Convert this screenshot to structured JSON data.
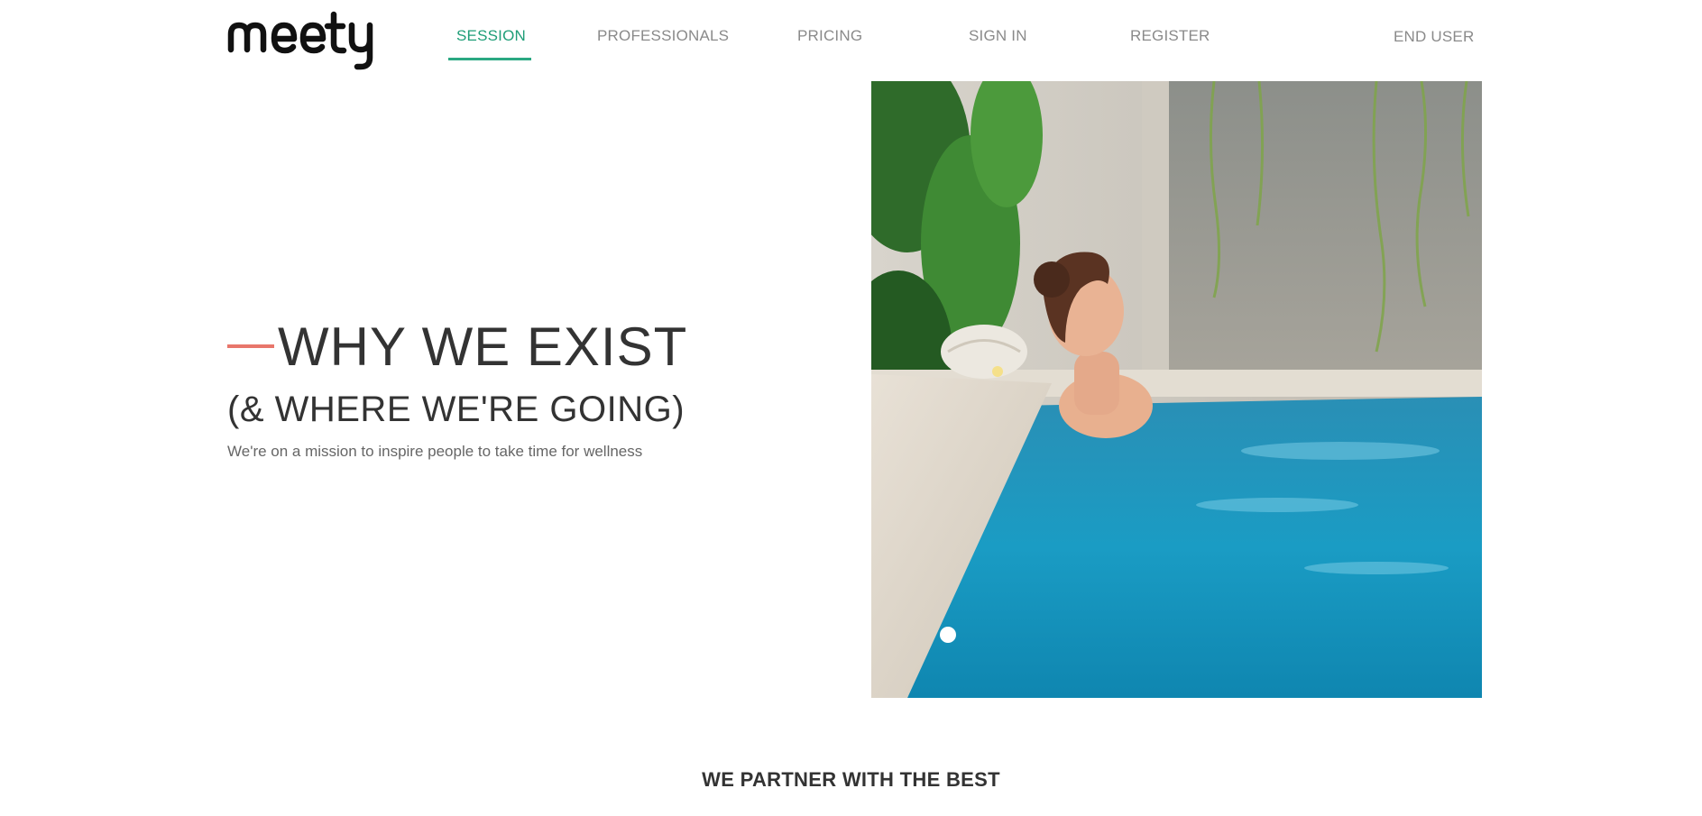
{
  "header": {
    "logo_text": "meety",
    "nav": [
      {
        "label": "SESSION",
        "active": true
      },
      {
        "label": "PROFESSIONALS",
        "active": false
      },
      {
        "label": "PRICING",
        "active": false
      },
      {
        "label": "SIGN IN",
        "active": false
      },
      {
        "label": "REGISTER",
        "active": false
      },
      {
        "label": "END USER",
        "active": false
      }
    ]
  },
  "hero": {
    "title": "WHY WE EXIST",
    "subtitle": "(& WHERE WE'RE GOING)",
    "text": "We're on a mission to inspire people to take time for wellness",
    "image_alt": "Woman relaxing at the edge of a pool",
    "carousel_dots": 1
  },
  "partners": {
    "heading": "WE PARTNER WITH THE BEST"
  },
  "colors": {
    "accent": "#2aa882",
    "dash": "#e8766b",
    "text": "#333333",
    "muted": "#8a8a8a"
  }
}
